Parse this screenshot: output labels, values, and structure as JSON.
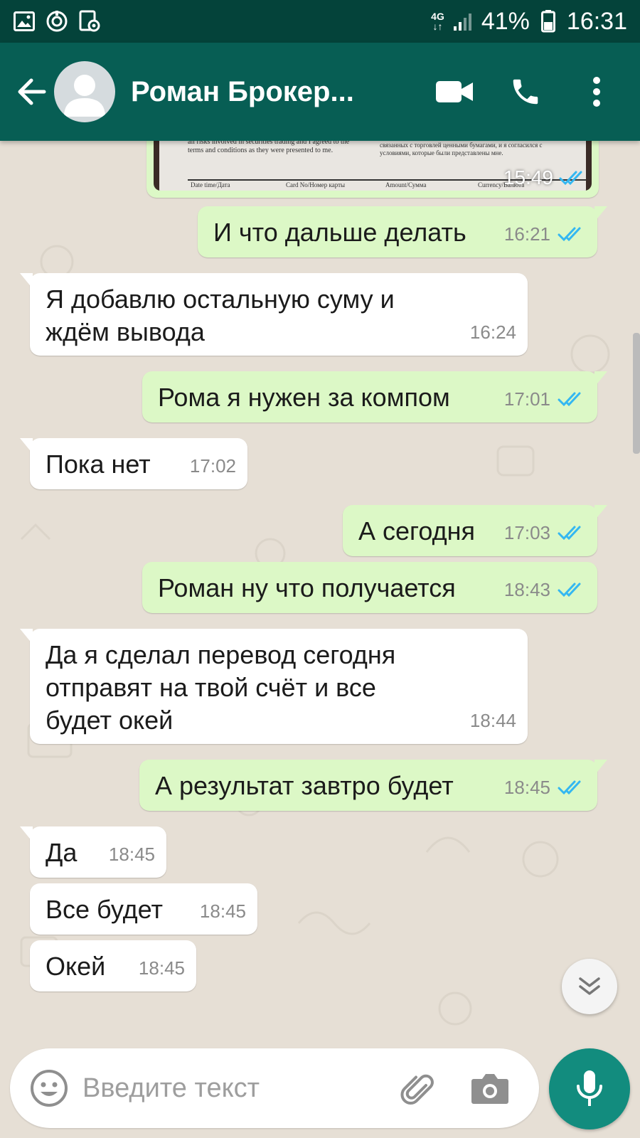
{
  "status_bar": {
    "network": "4G",
    "battery": "41%",
    "time": "16:31"
  },
  "header": {
    "contact_name": "Роман Брокер..."
  },
  "image_message": {
    "time": "15:49",
    "doc_lines": {
      "left": "all risks involved in securities trading and I agreed to the terms and conditions as they were presented to me.",
      "right": "систему, я был в полном контроле и знал обо всех рисках, связанных с торговлей ценными бумагами, и я согласился с условиями, которые были представлены мне.",
      "col1": "Date time/Дата",
      "col2": "Card No/Номер карты",
      "col3": "Amount/Сумма",
      "col4": "Currency/Валюта"
    }
  },
  "messages": [
    {
      "dir": "out",
      "text": "И что дальше делать",
      "time": "16:21"
    },
    {
      "dir": "in",
      "text": "Я добавлю остальную суму и\nждём вывода",
      "time": "16:24"
    },
    {
      "dir": "out",
      "text": "Рома я нужен за компом",
      "time": "17:01"
    },
    {
      "dir": "in",
      "text": "Пока нет",
      "time": "17:02"
    },
    {
      "dir": "out",
      "text": "А сегодня",
      "time": "17:03"
    },
    {
      "dir": "out",
      "text": "Роман ну что получается",
      "time": "18:43"
    },
    {
      "dir": "in",
      "text": "Да я сделал перевод сегодня\nотправят на твой счёт и все\nбудет окей",
      "time": "18:44"
    },
    {
      "dir": "out",
      "text": "А результат завтро будет",
      "time": "18:45"
    },
    {
      "dir": "in",
      "text": "Да",
      "time": "18:45"
    },
    {
      "dir": "in",
      "text": "Все будет",
      "time": "18:45"
    },
    {
      "dir": "in",
      "text": "Окей",
      "time": "18:45"
    }
  ],
  "composer": {
    "placeholder": "Введите текст"
  },
  "colors": {
    "status_bar": "#04433a",
    "app_bar": "#075e54",
    "outgoing_bubble": "#dcf8c6",
    "incoming_bubble": "#ffffff",
    "read_ticks": "#34b7f1",
    "mic_button": "#128c7e"
  },
  "icons": {
    "status_left": [
      "gallery-icon",
      "sync-icon",
      "screenshot-icon"
    ],
    "app_bar": [
      "back-arrow-icon",
      "video-call-icon",
      "phone-icon",
      "more-vert-icon"
    ],
    "composer": [
      "emoji-icon",
      "attach-icon",
      "camera-icon",
      "mic-icon"
    ],
    "fab": "chevron-double-down-icon"
  }
}
